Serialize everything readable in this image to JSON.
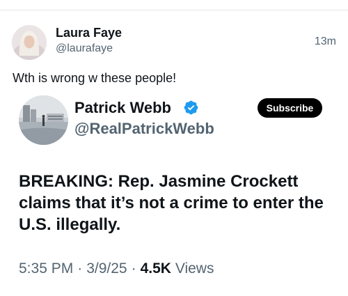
{
  "post": {
    "author_name": "Laura Faye",
    "author_handle": "@laurafaye",
    "timestamp": "13m",
    "text": "Wth is wrong w these people!"
  },
  "quoted": {
    "author_name": "Patrick Webb",
    "author_handle": "@RealPatrickWebb",
    "subscribe_label": "Subscribe",
    "verified_icon": "verified-badge-icon",
    "text": "BREAKING: Rep. Jasmine Crockett claims that it’s not a crime to enter the U.S. illegally.",
    "time": "5:35 PM",
    "date": "3/9/25",
    "separator": "·",
    "views_count": "4.5K",
    "views_label": "Views"
  },
  "colors": {
    "primary_text": "#0f1419",
    "secondary_text": "#536471",
    "verified_blue": "#1d9bf0",
    "button_bg": "#000000"
  }
}
